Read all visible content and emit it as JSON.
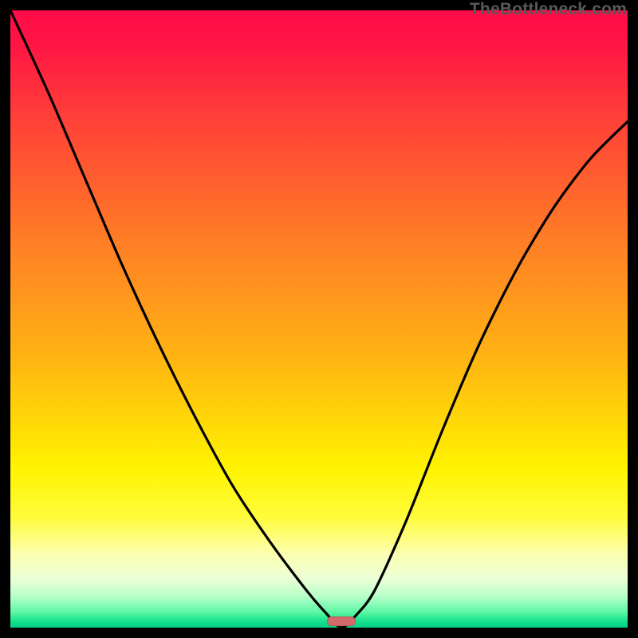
{
  "watermark": "TheBottleneck.com",
  "marker": {
    "cx_frac": 0.536,
    "cy_frac": 0.99,
    "color": "#d16a6a"
  },
  "chart_data": {
    "type": "line",
    "title": "",
    "xlabel": "",
    "ylabel": "",
    "xlim": [
      0,
      1
    ],
    "ylim": [
      0,
      1
    ],
    "gradient_stops": [
      {
        "pos": 0.0,
        "color": "#ff0a48"
      },
      {
        "pos": 0.3,
        "color": "#ff6a2a"
      },
      {
        "pos": 0.6,
        "color": "#ffc20e"
      },
      {
        "pos": 0.8,
        "color": "#fff94e"
      },
      {
        "pos": 0.92,
        "color": "#ecffd6"
      },
      {
        "pos": 1.0,
        "color": "#02cf84"
      }
    ],
    "series": [
      {
        "name": "bottleneck-curve",
        "x": [
          0.0,
          0.06,
          0.12,
          0.18,
          0.24,
          0.3,
          0.36,
          0.42,
          0.48,
          0.51,
          0.536,
          0.56,
          0.59,
          0.64,
          0.7,
          0.76,
          0.82,
          0.88,
          0.94,
          1.0
        ],
        "y": [
          1.0,
          0.87,
          0.73,
          0.59,
          0.46,
          0.34,
          0.23,
          0.14,
          0.06,
          0.025,
          0.0,
          0.02,
          0.06,
          0.17,
          0.32,
          0.46,
          0.58,
          0.68,
          0.76,
          0.82
        ]
      }
    ],
    "marker_point": {
      "x": 0.536,
      "y": 0.0
    }
  }
}
